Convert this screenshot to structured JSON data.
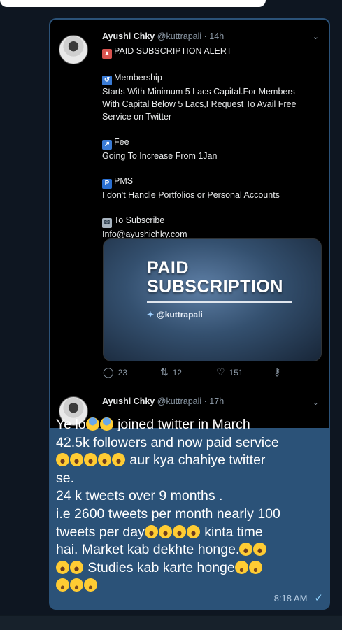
{
  "tweet1": {
    "name": "Ayushi Chky",
    "handle": "@kuttrapali",
    "time": "· 14h",
    "lines": [
      "PAID SUBSCRIPTION ALERT",
      "Membership",
      "Starts With Minimum 5 Lacs Capital.For Members",
      "With Capital Below 5 Lacs,I Request To Avail Free",
      "Service on Twitter",
      "Fee",
      "Going To Increase From 1Jan",
      "PMS",
      "I don't Handle Portfolios or Personal Accounts",
      "To Subscribe",
      "Info@ayushichky.com"
    ],
    "card": {
      "title_line1": "PAID",
      "title_line2": "SUBSCRIPTION",
      "handle": "@kuttrapali"
    },
    "replies": "23",
    "retweets": "12",
    "likes": "151"
  },
  "tweet2": {
    "name": "Ayushi Chky",
    "handle": "@kuttrapali",
    "time": "· 17h"
  },
  "message": {
    "lines": [
      "Ye lo",
      "joined twitter in March",
      "42.5k followers and now paid service",
      "aur kya chahiye twitter",
      "se.",
      "24 k tweets over 9 months .",
      "i.e 2600 tweets per month nearly 100",
      "tweets per day",
      "kinta time",
      "hai. Market kab dekhte honge.",
      "Studies kab karte honge"
    ],
    "time": "8:18 AM"
  },
  "icons": {
    "read_check": "double-check-icon",
    "reply": "reply-icon",
    "retweet": "retweet-icon",
    "like": "heart-icon",
    "share": "share-icon"
  }
}
